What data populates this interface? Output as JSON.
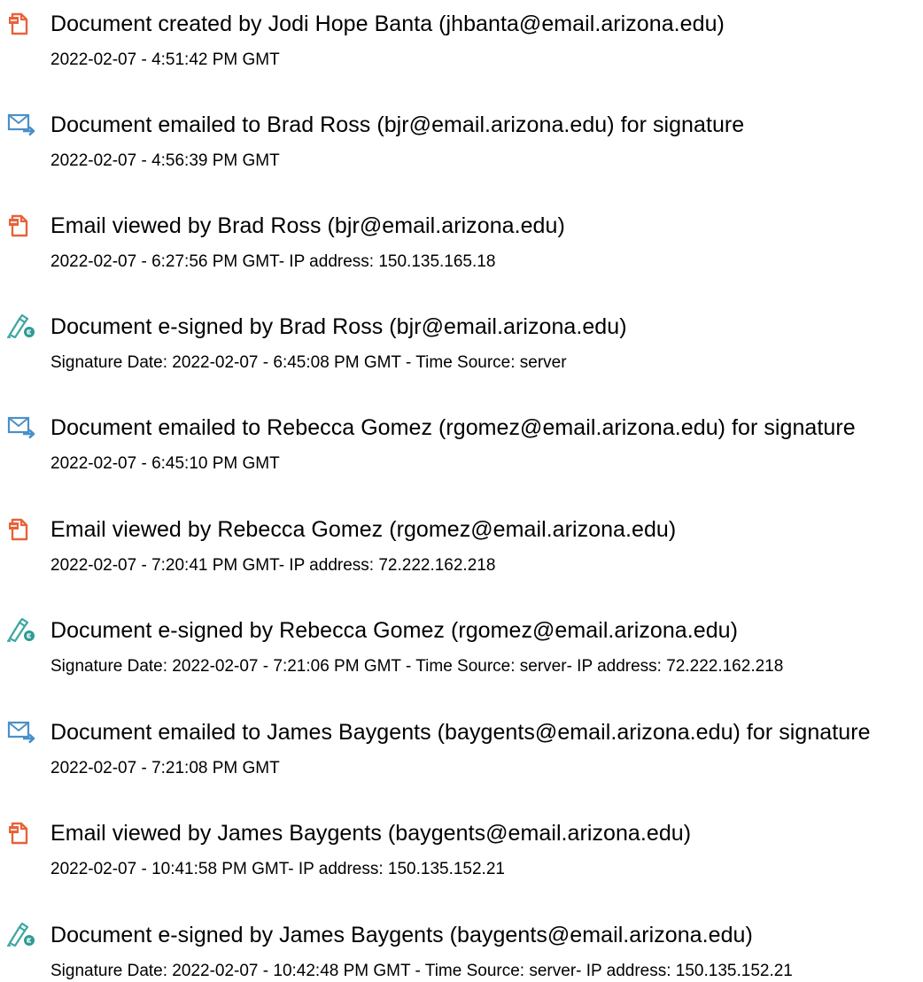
{
  "icon_colors": {
    "document": "#e8623a",
    "email": "#4a90c8",
    "signed_pen": "#3aa7a0",
    "signed_badge": "#2e9b94"
  },
  "events": [
    {
      "icon": "document-icon",
      "title": "Document created by Jodi Hope Banta (jhbanta@email.arizona.edu)",
      "detail": "2022-02-07 - 4:51:42 PM GMT"
    },
    {
      "icon": "email-icon",
      "title": "Document emailed to Brad Ross (bjr@email.arizona.edu) for signature",
      "detail": "2022-02-07 - 4:56:39 PM GMT"
    },
    {
      "icon": "document-icon",
      "title": "Email viewed by Brad Ross (bjr@email.arizona.edu)",
      "detail": "2022-02-07 - 6:27:56 PM GMT- IP address: 150.135.165.18"
    },
    {
      "icon": "signed-icon",
      "title": "Document e-signed by Brad Ross (bjr@email.arizona.edu)",
      "detail": "Signature Date: 2022-02-07 - 6:45:08 PM GMT - Time Source: server"
    },
    {
      "icon": "email-icon",
      "title": "Document emailed to Rebecca Gomez (rgomez@email.arizona.edu) for signature",
      "detail": "2022-02-07 - 6:45:10 PM GMT"
    },
    {
      "icon": "document-icon",
      "title": "Email viewed by Rebecca Gomez (rgomez@email.arizona.edu)",
      "detail": "2022-02-07 - 7:20:41 PM GMT- IP address: 72.222.162.218"
    },
    {
      "icon": "signed-icon",
      "title": "Document e-signed by Rebecca Gomez (rgomez@email.arizona.edu)",
      "detail": "Signature Date: 2022-02-07 - 7:21:06 PM GMT - Time Source: server- IP address: 72.222.162.218"
    },
    {
      "icon": "email-icon",
      "title": "Document emailed to James Baygents (baygents@email.arizona.edu) for signature",
      "detail": "2022-02-07 - 7:21:08 PM GMT"
    },
    {
      "icon": "document-icon",
      "title": "Email viewed by James Baygents (baygents@email.arizona.edu)",
      "detail": "2022-02-07 - 10:41:58 PM GMT- IP address: 150.135.152.21"
    },
    {
      "icon": "signed-icon",
      "title": "Document e-signed by James Baygents (baygents@email.arizona.edu)",
      "detail": "Signature Date: 2022-02-07 - 10:42:48 PM GMT - Time Source: server- IP address: 150.135.152.21"
    }
  ]
}
